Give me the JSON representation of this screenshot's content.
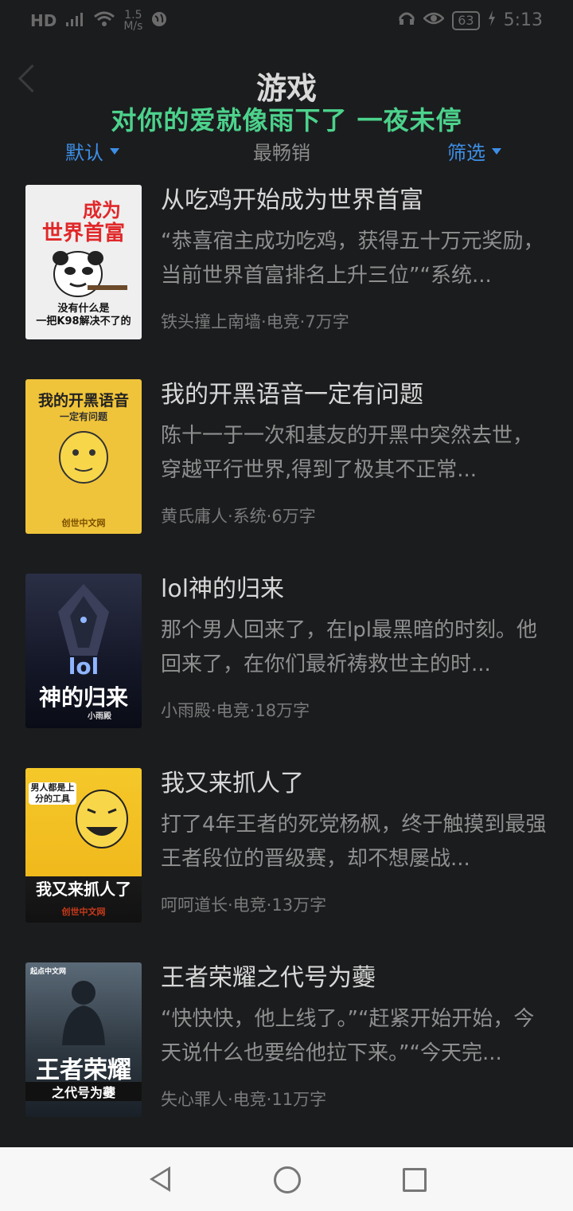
{
  "status": {
    "network": "HD",
    "signal": "4G",
    "speed_value": "1.5",
    "speed_unit": "M/s",
    "battery": "63",
    "time": "5:13"
  },
  "header": {
    "title": "游戏",
    "banner": "对你的爱就像雨下了 一夜未停"
  },
  "filters": {
    "default_label": "默认",
    "bestseller_label": "最畅销",
    "filter_label": "筛选"
  },
  "books": [
    {
      "title": "从吃鸡开始成为世界首富",
      "desc": "“恭喜宿主成功吃鸡，获得五十万元奖励，当前世界首富排名上升三位”“系统...",
      "meta": "铁头撞上南墙·电竞·7万字",
      "cover_text_top": "成为",
      "cover_text_mid": "世界首富",
      "cover_text_bottom": "没有什么是\n一把K98解决不了的"
    },
    {
      "title": "我的开黑语音一定有问题",
      "desc": "陈十一于一次和基友的开黑中突然去世，穿越平行世界,得到了极其不正常...",
      "meta": "黄氏庸人·系统·6万字",
      "cover_text_top": "我的开黑语音",
      "cover_text_mid": "一定有问题",
      "cover_text_bottom": "创世中文网"
    },
    {
      "title": "lol神的归来",
      "desc": "那个男人回来了，在lpl最黑暗的时刻。他回来了，在你们最祈祷救世主的时...",
      "meta": "小雨殿·电竞·18万字",
      "cover_text_top": "lol",
      "cover_text_mid": "神的归来",
      "cover_text_bottom": "小雨殿"
    },
    {
      "title": "我又来抓人了",
      "desc": "打了4年王者的死党杨枫，终于触摸到最强王者段位的晋级赛，却不想屡战...",
      "meta": "呵呵道长·电竞·13万字",
      "cover_text_top": "男人都是上分的工具",
      "cover_text_mid": "我又来抓人了",
      "cover_text_bottom": "创世中文网"
    },
    {
      "title": "王者荣耀之代号为虁",
      "desc": "“快快快，他上线了。”“赶紧开始开始，今天说什么也要给他拉下来。”“今天完...",
      "meta": "失心罪人·电竞·11万字",
      "cover_text_top": "起点中文网",
      "cover_text_mid": "王者荣耀",
      "cover_text_bottom": "之代号为虁"
    }
  ]
}
